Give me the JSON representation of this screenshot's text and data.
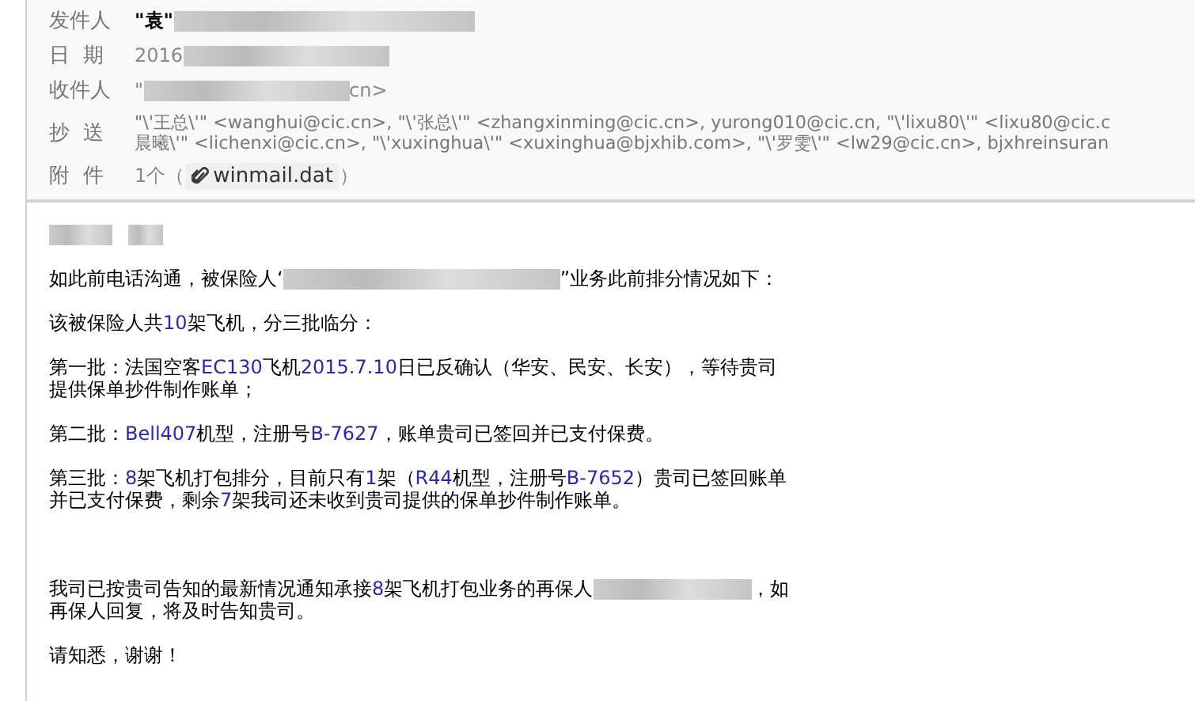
{
  "header": {
    "fields": [
      {
        "label": "发件人",
        "kind": "sender",
        "parts": [
          {
            "kind": "strong",
            "text": "\"袁\""
          },
          {
            "kind": "redacted"
          }
        ]
      },
      {
        "label": "日  期",
        "kind": "plain",
        "parts": [
          {
            "kind": "text",
            "text": "2016"
          },
          {
            "kind": "redacted"
          }
        ]
      },
      {
        "label": "收件人",
        "kind": "plain",
        "parts": [
          {
            "kind": "text",
            "text": "\""
          },
          {
            "kind": "redacted"
          },
          {
            "kind": "text",
            "text": "cn>"
          }
        ]
      },
      {
        "label": "抄  送",
        "kind": "lines",
        "lines": [
          "\"\\'王总\\'\" <wanghui@cic.cn>, \"\\'张总\\'\" <zhangxinming@cic.cn>, yurong010@cic.cn, \"\\'lixu80\\'\" <lixu80@cic.c",
          "晨曦\\'\" <lichenxi@cic.cn>, \"\\'xuxinghua\\'\" <xuxinghua@bjxhib.com>, \"\\'罗雯\\'\" <lw29@cic.cn>, bjxhreinsuran"
        ]
      },
      {
        "label": "附  件",
        "kind": "attachment",
        "count": "1个（",
        "file": "winmail.dat",
        "close": "）"
      }
    ]
  },
  "body": {
    "greeting": [
      {
        "kind": "redacted"
      },
      {
        "kind": "redacted"
      }
    ],
    "paragraphs": [
      [
        {
          "kind": "text",
          "text": "如此前电话沟通，被保险人‘"
        },
        {
          "kind": "redacted"
        },
        {
          "kind": "text",
          "text": "”业务此前排分情况如下："
        }
      ],
      [
        {
          "kind": "text",
          "text": "该被保险人共"
        },
        {
          "kind": "num",
          "text": "10"
        },
        {
          "kind": "text",
          "text": "架飞机，分三批临分："
        }
      ],
      [
        {
          "kind": "text",
          "text": "第一批：法国空客"
        },
        {
          "kind": "num",
          "text": "EC130"
        },
        {
          "kind": "text",
          "text": "飞机"
        },
        {
          "kind": "num",
          "text": "2015.7.10"
        },
        {
          "kind": "text",
          "text": "日已反确认（华安、民安、长安），等待贵司提供保单抄件制作账单；"
        }
      ],
      [
        {
          "kind": "text",
          "text": "第二批："
        },
        {
          "kind": "num",
          "text": "Bell407"
        },
        {
          "kind": "text",
          "text": "机型，注册号"
        },
        {
          "kind": "num",
          "text": "B-7627"
        },
        {
          "kind": "text",
          "text": "，账单贵司已签回并已支付保费。"
        }
      ],
      [
        {
          "kind": "text",
          "text": "第三批："
        },
        {
          "kind": "num",
          "text": "8"
        },
        {
          "kind": "text",
          "text": "架飞机打包排分，目前只有"
        },
        {
          "kind": "num",
          "text": "1"
        },
        {
          "kind": "text",
          "text": "架（"
        },
        {
          "kind": "num",
          "text": "R44"
        },
        {
          "kind": "text",
          "text": "机型，注册号"
        },
        {
          "kind": "num",
          "text": "B-7652"
        },
        {
          "kind": "text",
          "text": "）贵司已签回账单并已支付保费，剩余"
        },
        {
          "kind": "num",
          "text": "7"
        },
        {
          "kind": "text",
          "text": "架我司还未收到贵司提供的保单抄件制作账单。"
        }
      ],
      [
        {
          "kind": "text",
          "text": "我司已按贵司告知的最新情况通知承接"
        },
        {
          "kind": "num",
          "text": "8"
        },
        {
          "kind": "text",
          "text": "架飞机打包业务的再保人"
        },
        {
          "kind": "redacted"
        },
        {
          "kind": "text",
          "text": "，如再保人回复，将及时告知贵司。"
        }
      ],
      [
        {
          "kind": "text",
          "text": "请知悉，谢谢！"
        }
      ]
    ]
  }
}
